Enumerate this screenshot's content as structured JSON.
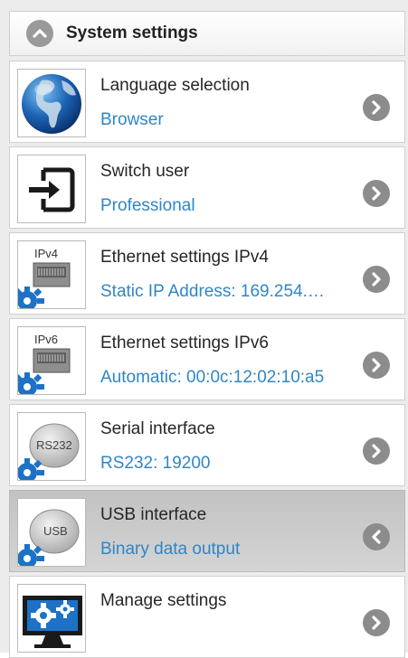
{
  "header": {
    "title": "System settings",
    "icon": "chevron-up-icon"
  },
  "items": [
    {
      "title": "Language selection",
      "value": "Browser",
      "icon": "globe-icon"
    },
    {
      "title": "Switch user",
      "value": "Professional",
      "icon": "login-arrow-icon"
    },
    {
      "title": "Ethernet settings IPv4",
      "value": "Static IP Address: 169.254.…",
      "icon": "ethernet-port-gear-icon",
      "badge": "IPv4"
    },
    {
      "title": "Ethernet settings IPv6",
      "value": "Automatic: 00:0c:12:02:10:a5",
      "icon": "ethernet-port-gear-icon",
      "badge": "IPv6"
    },
    {
      "title": "Serial interface",
      "value": "RS232: 19200",
      "icon": "rs232-port-gear-icon",
      "badge": "RS232"
    },
    {
      "title": "USB interface",
      "value": "Binary data output",
      "icon": "usb-port-gear-icon",
      "badge": "USB",
      "selected": true
    },
    {
      "title": "Manage settings",
      "value": "",
      "icon": "monitor-gears-icon"
    }
  ],
  "colors": {
    "accent": "#2f86c8",
    "selected_row": "#c8c8c8",
    "chevron": "#8c8c8c"
  }
}
